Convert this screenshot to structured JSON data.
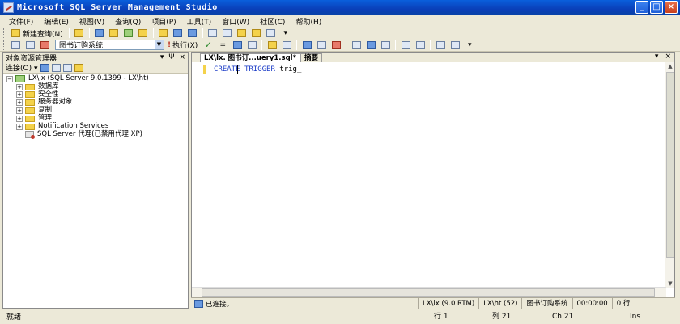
{
  "window": {
    "title": "Microsoft SQL Server Management Studio",
    "buttons": [
      "_",
      "□",
      "×"
    ]
  },
  "menu": [
    "文件(F)",
    "编辑(E)",
    "视图(V)",
    "查询(Q)",
    "项目(P)",
    "工具(T)",
    "窗口(W)",
    "社区(C)",
    "帮助(H)"
  ],
  "toolbar1": {
    "new_query": "新建查询(N)"
  },
  "toolbar2": {
    "database": "图书订购系统",
    "execute": "执行(X)"
  },
  "object_explorer": {
    "title": "对象资源管理器",
    "controls": [
      "▾",
      "Ψ",
      "×"
    ],
    "connect": "连接(O)",
    "server": "LX\\lx (SQL Server 9.0.1399 - LX\\ht)",
    "nodes": [
      "数据库",
      "安全性",
      "服务器对象",
      "复制",
      "管理",
      "Notification Services"
    ],
    "agent": "SQL Server 代理(已禁用代理 XP)"
  },
  "editor": {
    "tabs": [
      "LX\\lx. 图书订...uery1.sql*",
      "摘要"
    ],
    "code": {
      "kw1": "CREATE",
      "kw2": "TRIGGER",
      "rest": " trig_"
    }
  },
  "editor_status": {
    "connection": "已连接。",
    "server": "LX\\lx (9.0 RTM)",
    "user": "LX\\ht (52)",
    "database": "图书订购系统",
    "time": "00:00:00",
    "rows": "0 行"
  },
  "status": {
    "ready": "就绪",
    "line": "行 1",
    "col": "列 21",
    "ch": "Ch 21",
    "mode": "Ins"
  }
}
